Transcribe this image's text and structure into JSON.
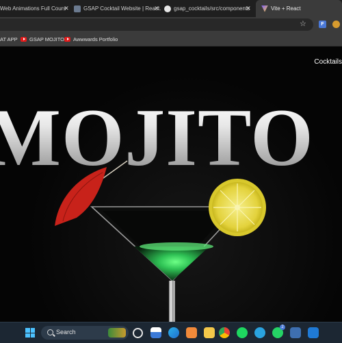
{
  "tabs": [
    {
      "label": "Web Animations Full Cours"
    },
    {
      "label": "GSAP Cocktail Website | React."
    },
    {
      "label": "gsap_cocktails/src/components"
    },
    {
      "label": "Vite + React"
    }
  ],
  "bookmarks": [
    {
      "label": "AT APP"
    },
    {
      "label": "GSAP MOJITO"
    },
    {
      "label": "Awwwards Portfolio"
    }
  ],
  "extension": {
    "label": "F"
  },
  "page": {
    "nav_link": "Cocktails",
    "hero_title": "MOJITO"
  },
  "taskbar": {
    "search_label": "Search",
    "whatsapp_badge": "2"
  },
  "colors": {
    "page_bg": "#050505",
    "umbrella": "#d42a1c",
    "lime": "#e8d94a",
    "drink": "#3fd46a",
    "taskbar": "#1c2733"
  }
}
